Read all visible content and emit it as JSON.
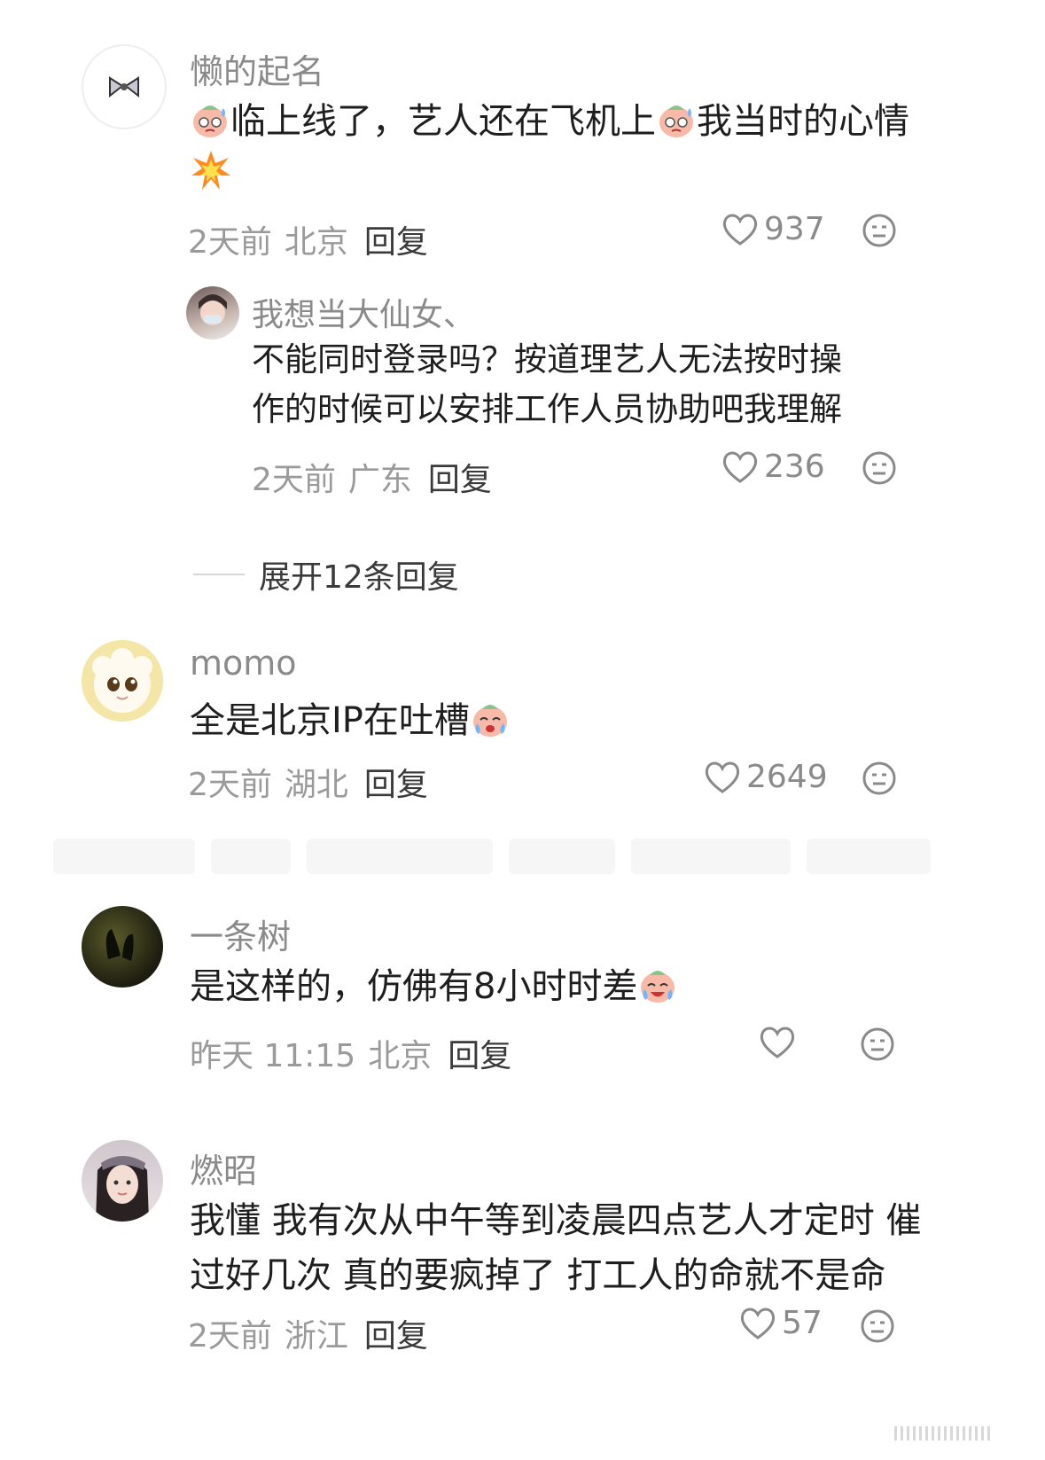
{
  "comments": [
    {
      "username": "懒的起名",
      "text_parts": [
        "临上线了，艺人还在飞机上",
        "我当时的心情"
      ],
      "time": "2天前",
      "location": "北京",
      "reply_label": "回复",
      "likes": "937",
      "replies": [
        {
          "username": "我想当大仙女、",
          "text_line1": "不能同时登录吗？按道理艺人无法按时操",
          "text_line2": "作的时候可以安排工作人员协助吧我理解",
          "time": "2天前",
          "location": "广东",
          "reply_label": "回复",
          "likes": "236"
        }
      ],
      "expand_label": "展开12条回复"
    },
    {
      "username": "momo",
      "text": "全是北京IP在吐槽",
      "time": "2天前",
      "location": "湖北",
      "reply_label": "回复",
      "likes": "2649"
    },
    {
      "username": "一条树",
      "text": "是这样的，仿佛有8小时时差",
      "time": "昨天 11:15",
      "location": "北京",
      "reply_label": "回复",
      "likes": ""
    },
    {
      "username": "燃昭",
      "text_line1": "我懂 我有次从中午等到凌晨四点艺人才定时 催",
      "text_line2": "过好几次 真的要疯掉了 打工人的命就不是命",
      "time": "2天前",
      "location": "浙江",
      "reply_label": "回复",
      "likes": "57"
    }
  ],
  "colors": {
    "username": "#8a8a8a",
    "text": "#1e1e1e",
    "meta": "#9a9a9a"
  },
  "icons": [
    "bow-icon",
    "sweat-face-emoji",
    "explosion-emoji",
    "crying-face-emoji",
    "laughing-tears-emoji",
    "heart-icon",
    "dislike-face-icon"
  ]
}
